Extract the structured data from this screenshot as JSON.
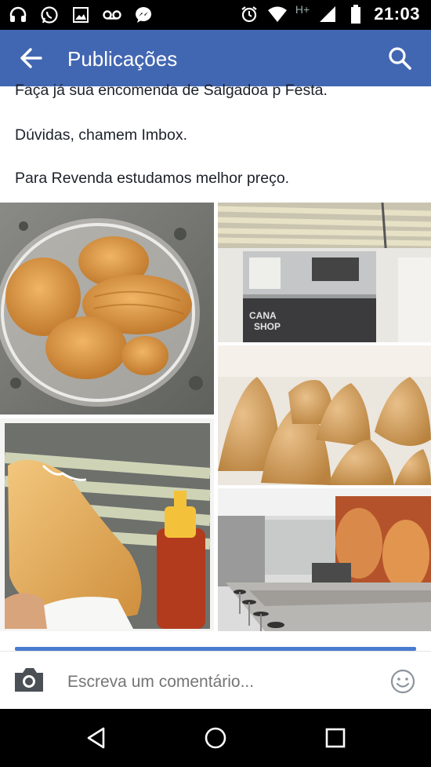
{
  "status_bar": {
    "time": "21:03",
    "network": "H+",
    "left_icons": [
      "headset-icon",
      "whatsapp-icon",
      "image-icon",
      "voicemail-icon",
      "messenger-icon"
    ],
    "right_icons": [
      "alarm-icon",
      "wifi-icon",
      "signal-icon",
      "battery-icon"
    ]
  },
  "app_bar": {
    "title": "Publicações",
    "color": "#4267b2"
  },
  "post": {
    "lines": [
      "Faça já sua encomenda de Salgadoa p Festa.",
      "Dúvidas, chamem Imbox.",
      "Para Revenda estudamos melhor preço."
    ]
  },
  "photos": [
    {
      "name": "photo-salgadinhos-cup"
    },
    {
      "name": "photo-cana-machine",
      "text_lines": [
        "CANA",
        "SHOP"
      ]
    },
    {
      "name": "photo-coxinhas"
    },
    {
      "name": "photo-pastel-cana"
    },
    {
      "name": "photo-shop-interior"
    }
  ],
  "comment": {
    "placeholder": "Escreva um comentário..."
  },
  "colors": {
    "accent": "#4267b2",
    "strip": "#4a7bd0",
    "text": "#1d2129",
    "placeholder": "#8d949e"
  }
}
